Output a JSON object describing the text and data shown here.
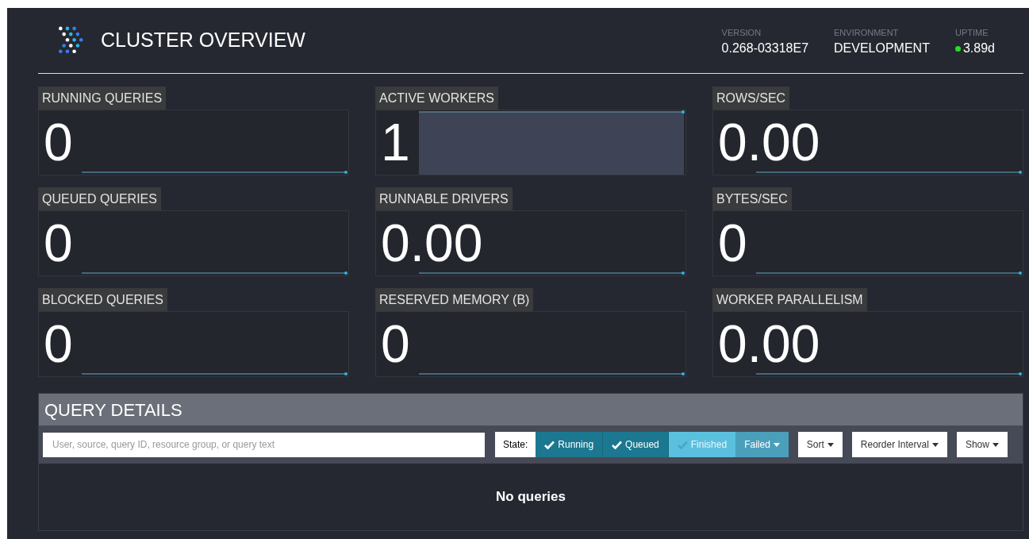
{
  "header": {
    "title": "CLUSTER OVERVIEW",
    "stats": [
      {
        "label": "VERSION",
        "value": "0.268-03318E7"
      },
      {
        "label": "ENVIRONMENT",
        "value": "DEVELOPMENT"
      },
      {
        "label": "UPTIME",
        "value": "3.89d",
        "status": true
      }
    ]
  },
  "metrics": [
    {
      "label": "RUNNING QUERIES",
      "value": "0",
      "kind": "line"
    },
    {
      "label": "ACTIVE WORKERS",
      "value": "1",
      "kind": "area"
    },
    {
      "label": "ROWS/SEC",
      "value": "0.00",
      "kind": "line"
    },
    {
      "label": "QUEUED QUERIES",
      "value": "0",
      "kind": "line"
    },
    {
      "label": "RUNNABLE DRIVERS",
      "value": "0.00",
      "kind": "line"
    },
    {
      "label": "BYTES/SEC",
      "value": "0",
      "kind": "line"
    },
    {
      "label": "BLOCKED QUERIES",
      "value": "0",
      "kind": "line"
    },
    {
      "label": "RESERVED MEMORY (B)",
      "value": "0",
      "kind": "line"
    },
    {
      "label": "WORKER PARALLELISM",
      "value": "0.00",
      "kind": "line"
    }
  ],
  "query_details": {
    "title": "QUERY DETAILS",
    "search": {
      "placeholder": "User, source, query ID, resource group, or query text"
    },
    "state_label": "State:",
    "states": [
      {
        "label": "Running",
        "kind": "toggle",
        "checked": true
      },
      {
        "label": "Queued",
        "kind": "toggle",
        "checked": true
      },
      {
        "label": "Finished",
        "kind": "toggle",
        "checked": false
      },
      {
        "label": "Failed",
        "kind": "dropdown"
      }
    ],
    "menus": [
      "Sort",
      "Reorder Interval",
      "Show"
    ],
    "empty_message": "No queries"
  }
}
